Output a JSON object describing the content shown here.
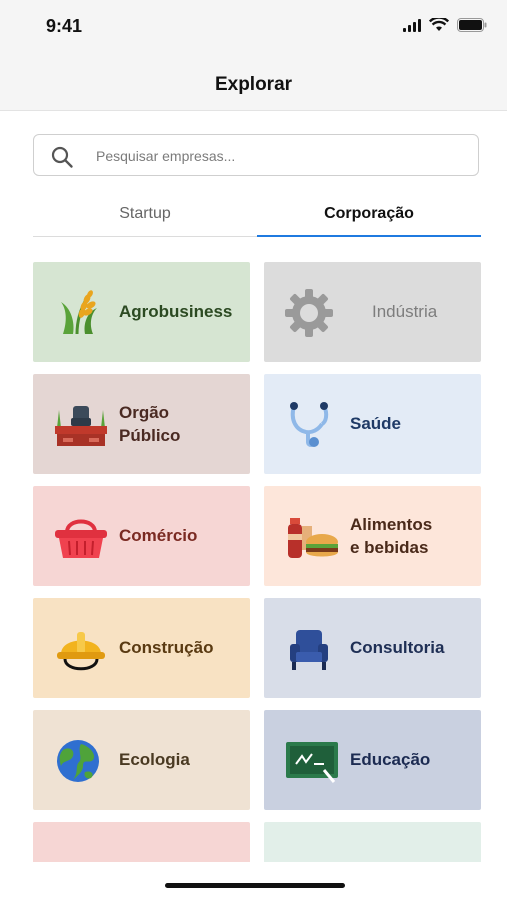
{
  "status_bar": {
    "time": "9:41"
  },
  "header": {
    "title": "Explorar"
  },
  "search": {
    "placeholder": "Pesquisar empresas..."
  },
  "tabs": [
    {
      "label": "Startup",
      "active": false
    },
    {
      "label": "Corporação",
      "active": true
    }
  ],
  "categories": [
    {
      "label_lines": [
        "Agrobusiness"
      ],
      "icon": "wheat-icon",
      "bg": "#d6e5d2",
      "color": "#2c4a22"
    },
    {
      "label_lines": [
        "Indústria"
      ],
      "icon": "gear-icon",
      "bg": "#dcdcdc",
      "color": "#7d7d7d"
    },
    {
      "label_lines": [
        "Orgão",
        "Público"
      ],
      "icon": "office-desk-icon",
      "bg": "#e4d6d3",
      "color": "#4a2a22"
    },
    {
      "label_lines": [
        "Saúde"
      ],
      "icon": "stethoscope-icon",
      "bg": "#e3ebf6",
      "color": "#1f3a66"
    },
    {
      "label_lines": [
        "Comércio"
      ],
      "icon": "basket-icon",
      "bg": "#f6d6d4",
      "color": "#7a2a22"
    },
    {
      "label_lines": [
        "Alimentos",
        "e bebidas"
      ],
      "icon": "food-drink-icon",
      "bg": "#fde6da",
      "color": "#4a2a1a"
    },
    {
      "label_lines": [
        "Construção"
      ],
      "icon": "hard-hat-icon",
      "bg": "#f8e2c3",
      "color": "#5a3a12"
    },
    {
      "label_lines": [
        "Consultoria"
      ],
      "icon": "armchair-icon",
      "bg": "#d8dde8",
      "color": "#1f2f55"
    },
    {
      "label_lines": [
        "Ecologia"
      ],
      "icon": "globe-icon",
      "bg": "#efe2d3",
      "color": "#4a3a22"
    },
    {
      "label_lines": [
        "Educação"
      ],
      "icon": "blackboard-icon",
      "bg": "#c9d0e0",
      "color": "#1c2b52"
    },
    {
      "label_lines": [
        ""
      ],
      "icon": "partial-icon",
      "bg": "#f6d6d4",
      "color": "#7a2a22"
    },
    {
      "label_lines": [
        ""
      ],
      "icon": "partial-icon",
      "bg": "#e2efe9",
      "color": "#2c4a3a"
    }
  ]
}
